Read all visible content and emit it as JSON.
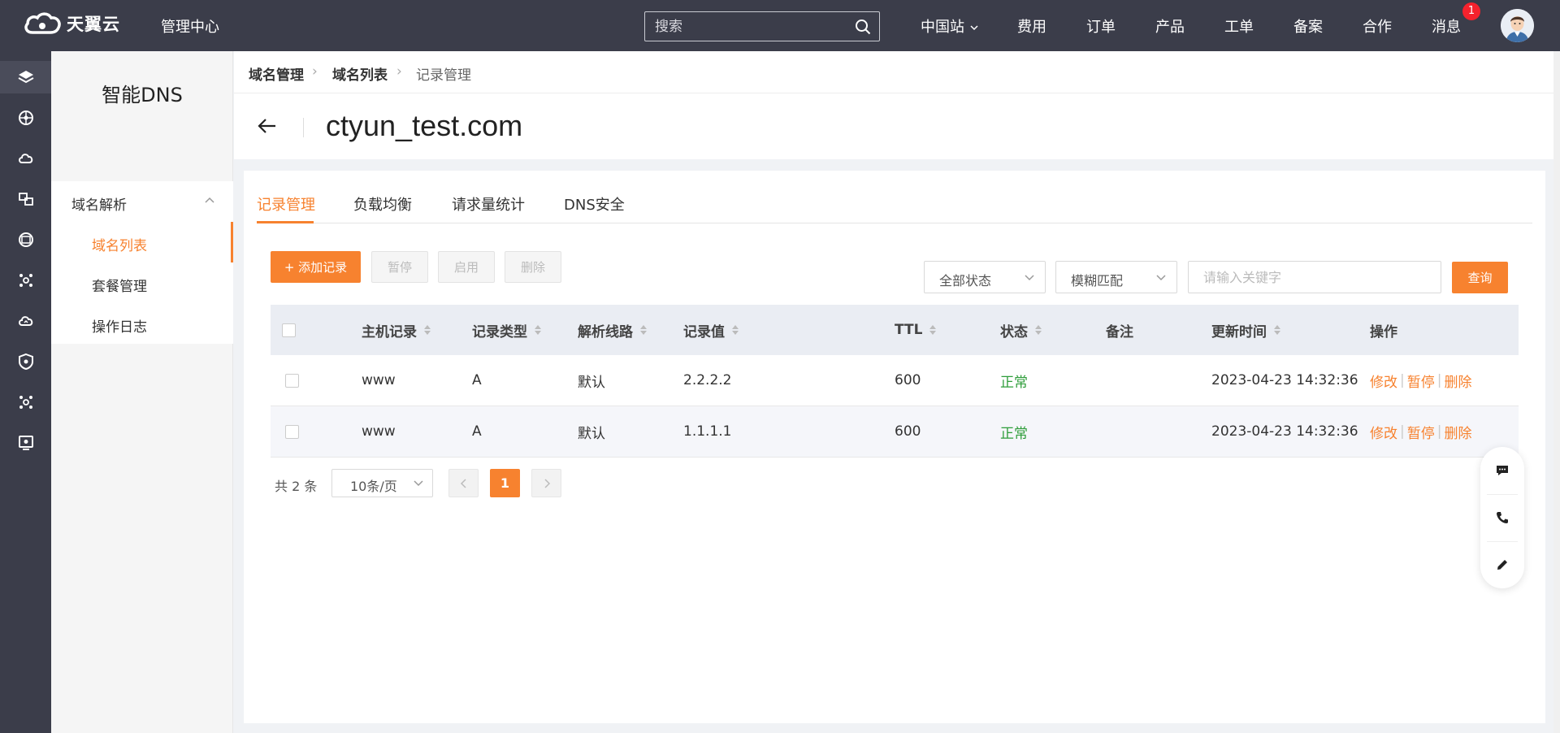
{
  "app": {
    "logo_text": "天翼云",
    "management_center": "管理中心"
  },
  "topbar": {
    "search_placeholder": "搜索",
    "nav": [
      {
        "label": "中国站"
      },
      {
        "label": "费用"
      },
      {
        "label": "订单"
      },
      {
        "label": "产品"
      },
      {
        "label": "工单"
      },
      {
        "label": "备案"
      },
      {
        "label": "合作"
      },
      {
        "label": "消息"
      }
    ],
    "message_badge": "1"
  },
  "rail_icons": [
    "layers-icon",
    "network-icon",
    "cloud-icon",
    "translate-icon",
    "browser-icon",
    "hub-icon",
    "cloud-sync-icon",
    "shield-icon",
    "hub-alt-icon",
    "monitor-icon"
  ],
  "sidebar": {
    "title": "智能DNS",
    "group": "域名解析",
    "items": [
      {
        "label": "域名列表",
        "active": true
      },
      {
        "label": "套餐管理",
        "active": false
      },
      {
        "label": "操作日志",
        "active": false
      }
    ]
  },
  "breadcrumb": [
    "域名管理",
    "域名列表",
    "记录管理"
  ],
  "page": {
    "domain": "ctyun_test.com"
  },
  "tabs": [
    "记录管理",
    "负载均衡",
    "请求量统计",
    "DNS安全"
  ],
  "toolbar": {
    "add": "+ 添加记录",
    "pause": "暂停",
    "enable": "启用",
    "delete": "删除",
    "status_filter": "全部状态",
    "match_mode": "模糊匹配",
    "keyword_placeholder": "请输入关键字",
    "query": "查询"
  },
  "table": {
    "columns": [
      "主机记录",
      "记录类型",
      "解析线路",
      "记录值",
      "TTL",
      "状态",
      "备注",
      "更新时间",
      "操作"
    ],
    "rows": [
      {
        "host": "www",
        "type": "A",
        "line": "默认",
        "value": "2.2.2.2",
        "ttl": "600",
        "status": "正常",
        "remark": "",
        "updated": "2023-04-23 14:32:36"
      },
      {
        "host": "www",
        "type": "A",
        "line": "默认",
        "value": "1.1.1.1",
        "ttl": "600",
        "status": "正常",
        "remark": "",
        "updated": "2023-04-23 14:32:36"
      }
    ],
    "actions": [
      "修改",
      "暂停",
      "删除"
    ]
  },
  "pagination": {
    "total": "共 2 条",
    "page_size": "10条/页",
    "current": "1"
  },
  "colors": {
    "accent": "#f7822f",
    "topbar": "#3b3d4a",
    "status_ok": "#2e9d3a"
  }
}
